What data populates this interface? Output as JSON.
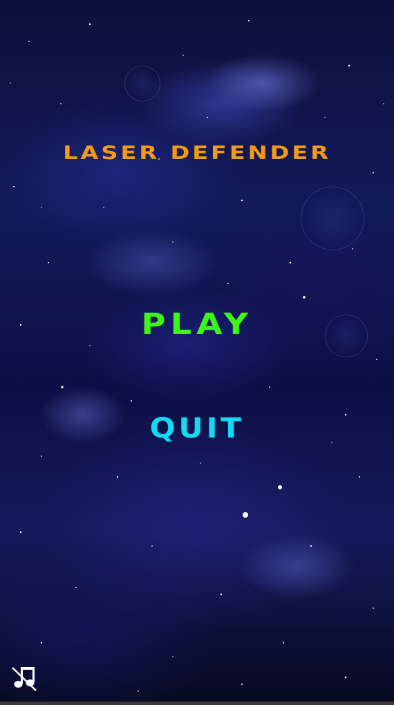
{
  "game": {
    "title": "Laser Defender"
  },
  "menu": {
    "play_label": "Play",
    "quit_label": "Quit"
  },
  "controls": {
    "music_toggle_icon": "music-muted-icon"
  },
  "colors": {
    "title": "#f59a12",
    "play": "#3ef51a",
    "quit": "#14d9f2",
    "background": "#0d0f3a"
  }
}
